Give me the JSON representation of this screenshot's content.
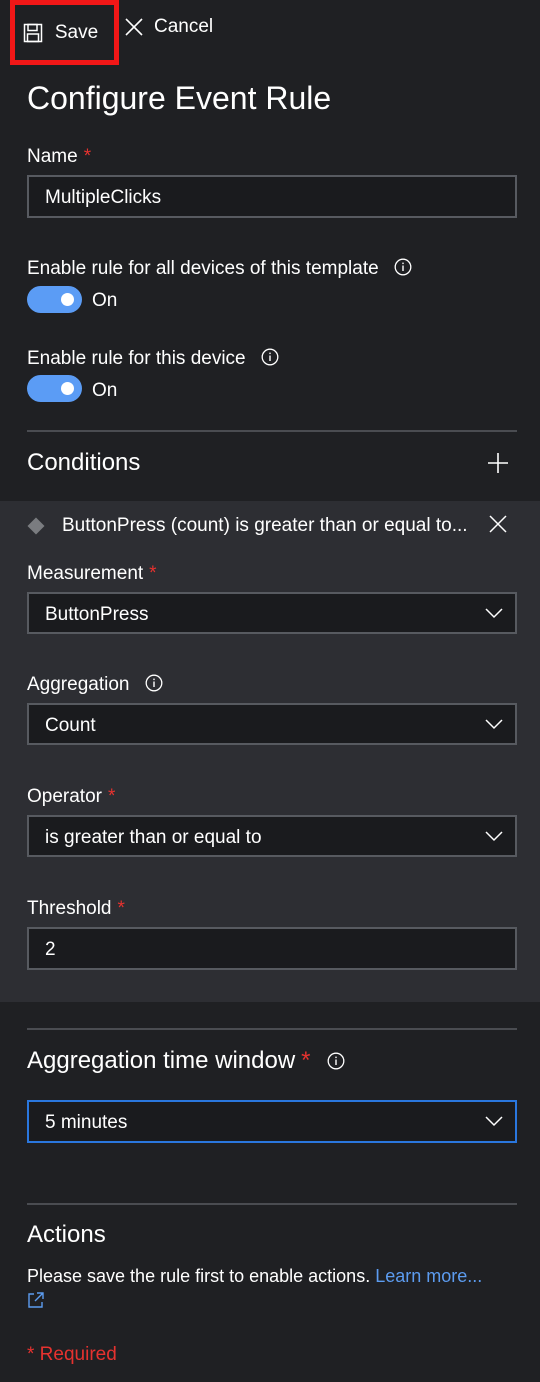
{
  "toolbar": {
    "save_label": "Save",
    "cancel_label": "Cancel"
  },
  "page_title": "Configure Event Rule",
  "name_field": {
    "label": "Name",
    "required_mark": "*",
    "value": "MultipleClicks"
  },
  "toggles": [
    {
      "label": "Enable rule for all devices of this template",
      "state_label": "On",
      "on": true
    },
    {
      "label": "Enable rule for this device",
      "state_label": "On",
      "on": true
    }
  ],
  "conditions": {
    "title": "Conditions",
    "item": {
      "summary": "ButtonPress (count) is greater than or equal to...",
      "measurement": {
        "label": "Measurement",
        "required_mark": "*",
        "value": "ButtonPress"
      },
      "aggregation": {
        "label": "Aggregation",
        "value": "Count"
      },
      "operator": {
        "label": "Operator",
        "required_mark": "*",
        "value": "is greater than or equal to"
      },
      "threshold": {
        "label": "Threshold",
        "required_mark": "*",
        "value": "2"
      }
    }
  },
  "time_window": {
    "label": "Aggregation time window",
    "required_mark": "*",
    "value": "5 minutes"
  },
  "actions": {
    "title": "Actions",
    "help_text": "Please save the rule first to enable actions.",
    "link_text": "Learn more..."
  },
  "required_note": "* Required",
  "colors": {
    "accent": "#5b9cf5",
    "required": "#e6322f",
    "highlight": "#f11717",
    "focus_border": "#2a77de"
  }
}
